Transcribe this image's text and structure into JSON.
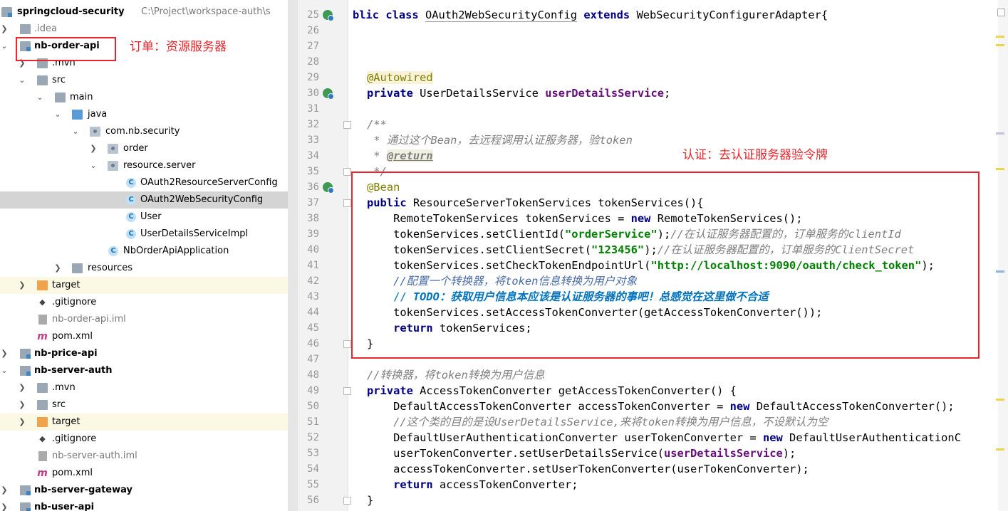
{
  "project_tree": {
    "root": {
      "name": "springcloud-security",
      "path": "C:\\Project\\workspace-auth\\s"
    },
    "items": [
      {
        "label": ".idea"
      },
      {
        "label": "nb-order-api"
      },
      {
        "label": ".mvn"
      },
      {
        "label": "src"
      },
      {
        "label": "main"
      },
      {
        "label": "java"
      },
      {
        "label": "com.nb.security"
      },
      {
        "label": "order"
      },
      {
        "label": "resource.server"
      },
      {
        "label": "OAuth2ResourceServerConfig"
      },
      {
        "label": "OAuth2WebSecurityConfig"
      },
      {
        "label": "User"
      },
      {
        "label": "UserDetailsServiceImpl"
      },
      {
        "label": "NbOrderApiApplication"
      },
      {
        "label": "resources"
      },
      {
        "label": "target"
      },
      {
        "label": ".gitignore"
      },
      {
        "label": "nb-order-api.iml"
      },
      {
        "label": "pom.xml"
      },
      {
        "label": "nb-price-api"
      },
      {
        "label": "nb-server-auth"
      },
      {
        "label": ".mvn"
      },
      {
        "label": "src"
      },
      {
        "label": "target"
      },
      {
        "label": ".gitignore"
      },
      {
        "label": "nb-server-auth.iml"
      },
      {
        "label": "pom.xml"
      },
      {
        "label": "nb-server-gateway"
      },
      {
        "label": "nb-user-api"
      }
    ]
  },
  "annotations": {
    "order_note": "订单：资源服务器",
    "auth_note": "认证：去认证服务器验令牌"
  },
  "editor": {
    "line_numbers": [
      "25",
      "26",
      "27",
      "28",
      "29",
      "30",
      "31",
      "32",
      "33",
      "34",
      "35",
      "36",
      "37",
      "38",
      "39",
      "40",
      "41",
      "42",
      "43",
      "44",
      "45",
      "46",
      "47",
      "48",
      "49",
      "50",
      "51",
      "52",
      "53",
      "54",
      "55",
      "56"
    ],
    "code": {
      "l25_kw1": "blic class ",
      "l25_cls": "OAuth2WebSecurityConfig",
      "l25_kw2": " extends ",
      "l25_rest": "WebSecurityConfigurerAdapter{",
      "l29_ann": "@Autowired",
      "l30_kw": "private ",
      "l30_type": "UserDetailsService ",
      "l30_fld": "userDetailsService",
      "l30_end": ";",
      "l32": "/**",
      "l33": " * 通过这个Bean，去远程调用认证服务器，验token",
      "l34_star": " * ",
      "l34_tag": "@return",
      "l35": " */",
      "l36_ann": "@Bean",
      "l37_kw": "public ",
      "l37_rest": "ResourceServerTokenServices tokenServices(){",
      "l38_a": "    RemoteTokenServices tokenServices = ",
      "l38_kw": "new ",
      "l38_b": "RemoteTokenServices();",
      "l39_a": "    tokenServices.setClientId(",
      "l39_str": "\"orderService\"",
      "l39_b": ");",
      "l39_cmt": "//在认证服务器配置的，订单服务的clientId",
      "l40_a": "    tokenServices.setClientSecret(",
      "l40_str": "\"123456\"",
      "l40_b": ");",
      "l40_cmt": "//在认证服务器配置的，订单服务的ClientSecret",
      "l41_a": "    tokenServices.setCheckTokenEndpointUrl(",
      "l41_str": "\"http://localhost:9090/oauth/check_token\"",
      "l41_b": ");",
      "l42_cmt": "    //配置一个转换器，将token信息转换为用户对象",
      "l43_a": "    // ",
      "l43_todo": "TODO：获取用户信息本应该是认证服务器的事吧！总感觉在这里做不合适",
      "l44": "    tokenServices.setAccessTokenConverter(getAccessTokenConverter());",
      "l45_kw": "    return ",
      "l45_rest": "tokenServices;",
      "l46": "}",
      "l48_cmt": "//转换器，将token转换为用户信息",
      "l49_kw": "private ",
      "l49_rest": "AccessTokenConverter getAccessTokenConverter() {",
      "l50_a": "    DefaultAccessTokenConverter accessTokenConverter = ",
      "l50_kw": "new ",
      "l50_b": "DefaultAccessTokenConverter();",
      "l51_cmt": "    //这个类的目的是设UserDetailsService,来将token转换为用户信息，不设默认为空",
      "l52_a": "    DefaultUserAuthenticationConverter userTokenConverter = ",
      "l52_kw": "new ",
      "l52_b": "DefaultUserAuthenticationC",
      "l53_a": "    userTokenConverter.setUserDetailsService(",
      "l53_fld": "userDetailsService",
      "l53_b": ");",
      "l54": "    accessTokenConverter.setUserTokenConverter(userTokenConverter);",
      "l55_kw": "    return ",
      "l55_rest": "accessTokenConverter;",
      "l56": "}"
    }
  },
  "colors": {
    "annotation_red": "#e8262b",
    "keyword": "#000080",
    "string": "#008000",
    "field": "#660e7a",
    "comment": "#808080",
    "todo": "#0073bf"
  }
}
